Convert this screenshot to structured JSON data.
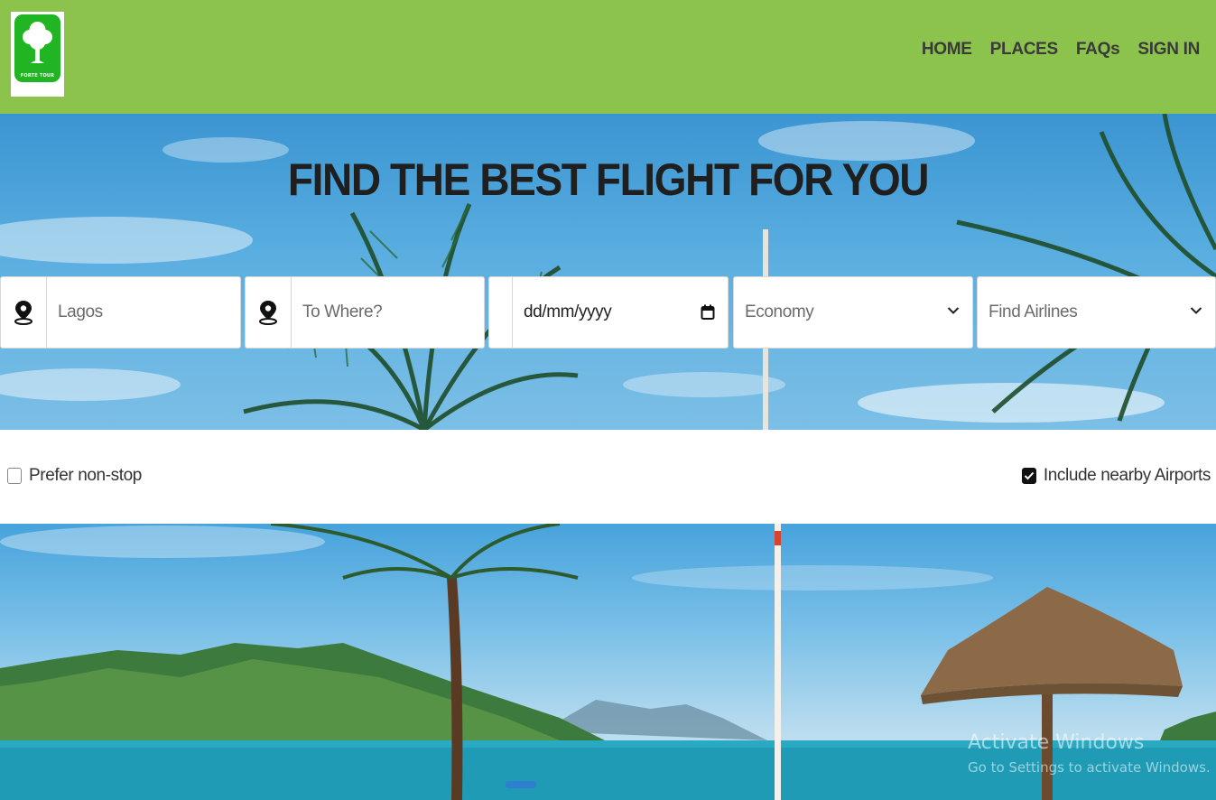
{
  "header": {
    "logo_text": "FORTE TOUR",
    "nav": [
      "HOME",
      "PLACES",
      "FAQs",
      "SIGN IN"
    ],
    "background_color": "#8cc34d"
  },
  "hero": {
    "title": "FIND THE BEST FLIGHT FOR YOU"
  },
  "search": {
    "from_value": "Lagos",
    "to_placeholder": "To Where?",
    "date_placeholder": "dd/mm/yyyy",
    "cabin_class": "Economy",
    "airlines": "Find Airlines"
  },
  "options": {
    "prefer_nonstop": {
      "label": "Prefer non-stop",
      "checked": false
    },
    "nearby_airports": {
      "label": "Include nearby Airports",
      "checked": true
    }
  },
  "watermark": {
    "line1": "Activate Windows",
    "line2": "Go to Settings to activate Windows."
  }
}
